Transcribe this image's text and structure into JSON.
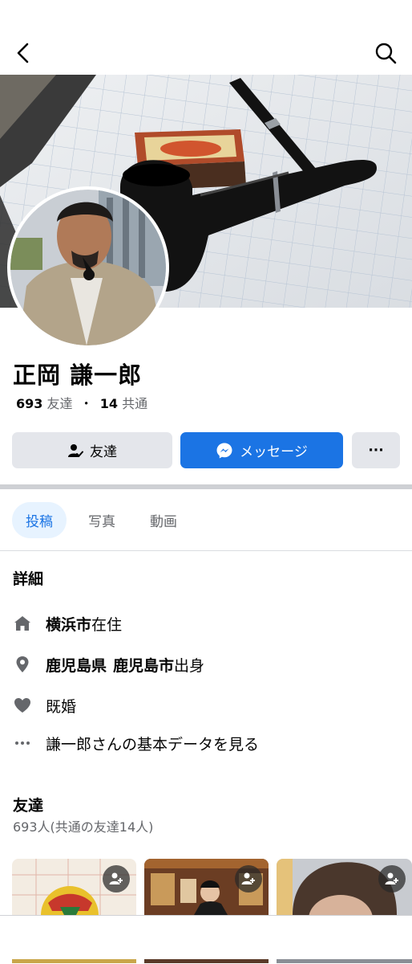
{
  "profile": {
    "name": "正岡 謙一郎",
    "friend_count": "693",
    "friends_word": "友達",
    "separator": "・",
    "mutual_count": "14",
    "mutual_word": "共通"
  },
  "actions": {
    "friends_label": "友達",
    "message_label": "メッセージ",
    "more_label": "···"
  },
  "tabs": [
    {
      "label": "投稿",
      "active": true
    },
    {
      "label": "写真",
      "active": false
    },
    {
      "label": "動画",
      "active": false
    }
  ],
  "details": {
    "title": "詳細",
    "residence_bold": "横浜市",
    "residence_suffix": "在住",
    "hometown_bold1": "鹿児島県",
    "hometown_bold2": "鹿児島市",
    "hometown_suffix": "出身",
    "relationship": "既婚",
    "about_link": "謙一郎さんの基本データを見る"
  },
  "friends_section": {
    "title": "友達",
    "subtitle": "693人(共通の友達14人)"
  },
  "colors": {
    "accent": "#1b74e4",
    "secondary_button": "#e4e6eb",
    "text_secondary": "#65676b"
  },
  "icons": [
    "back-arrow-icon",
    "search-icon",
    "friend-check-icon",
    "messenger-icon",
    "more-icon",
    "home-icon",
    "location-pin-icon",
    "heart-icon",
    "dots-icon",
    "add-friend-icon"
  ]
}
